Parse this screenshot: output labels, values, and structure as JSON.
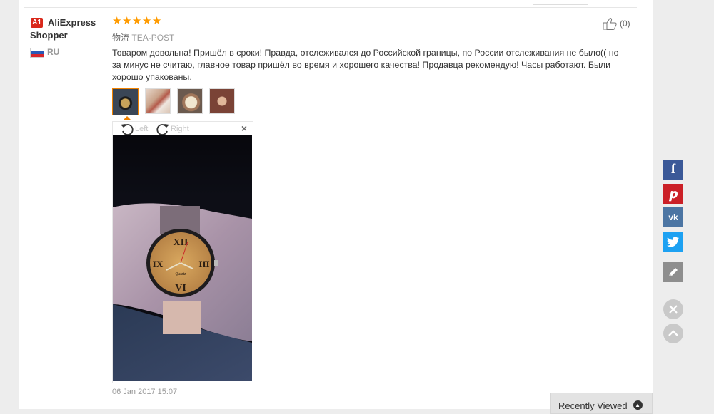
{
  "user": {
    "level_badge": "A1",
    "name": "AliExpress Shopper",
    "country": "RU"
  },
  "review": {
    "stars": [
      "★",
      "★",
      "★",
      "★",
      "★"
    ],
    "logistics_label": "物流",
    "logistics_value": "TEA-POST",
    "text": "Товаром довольна! Пришёл в сроки! Правда, отслеживался до Российской границы, по России отслеживания не было(( но за минус не считаю, главное товар пришёл во время и хорошего качества! Продавца рекомендую! Часы работают. Были хорошо упакованы.",
    "helpful_count": "(0)",
    "date": "06 Jan 2017 15:07"
  },
  "viewer": {
    "rotate_left": "Left",
    "rotate_right": "Right",
    "close": "×"
  },
  "recently_viewed": {
    "label": "Recently Viewed"
  },
  "colors": {
    "accent": "#f08200",
    "stars": "#ff9b00",
    "facebook": "#3b5998",
    "pinterest": "#cb2027",
    "vk": "#4c75a3",
    "twitter": "#1da1f2"
  },
  "icons": [
    "thumbs-up-icon",
    "rotate-left-icon",
    "rotate-right-icon",
    "close-icon",
    "facebook-icon",
    "pinterest-icon",
    "vk-icon",
    "twitter-icon",
    "pencil-icon",
    "close-circle-icon",
    "chevron-up-icon"
  ]
}
